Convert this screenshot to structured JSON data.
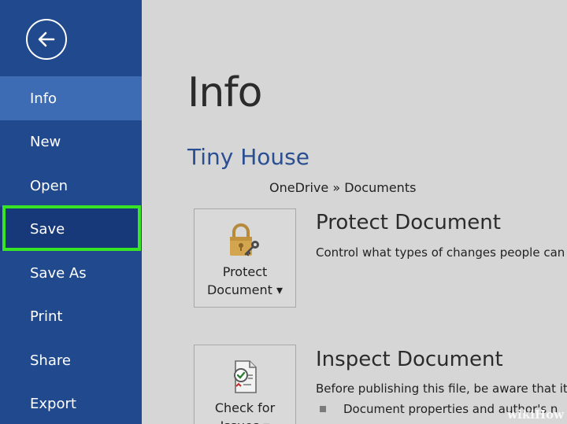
{
  "sidebar": {
    "back_icon": "arrow-left-icon",
    "items": [
      {
        "label": "Info",
        "state": "active"
      },
      {
        "label": "New"
      },
      {
        "label": "Open"
      },
      {
        "label": "Save",
        "state": "highlighted"
      },
      {
        "label": "Save As"
      },
      {
        "label": "Print"
      },
      {
        "label": "Share"
      },
      {
        "label": "Export"
      }
    ]
  },
  "main": {
    "title": "Info",
    "doc_name": "Tiny House",
    "doc_path": "OneDrive » Documents",
    "protect": {
      "button_line1": "Protect",
      "button_line2": "Document ▾",
      "icon": "lock-key-icon",
      "title": "Protect Document",
      "description": "Control what types of changes people can"
    },
    "inspect": {
      "button_line1": "Check for",
      "button_line2": "Issues ▾",
      "icon": "inspect-document-icon",
      "title": "Inspect Document",
      "description": "Before publishing this file, be aware that it",
      "bullet": "Document properties and author's n"
    }
  },
  "watermark": "wikiHow",
  "colors": {
    "sidebar": "#21498e",
    "active_item": "#3d6cb5",
    "highlight": "#38e524",
    "doc_name": "#2a4f91",
    "background": "#d6d6d6"
  }
}
